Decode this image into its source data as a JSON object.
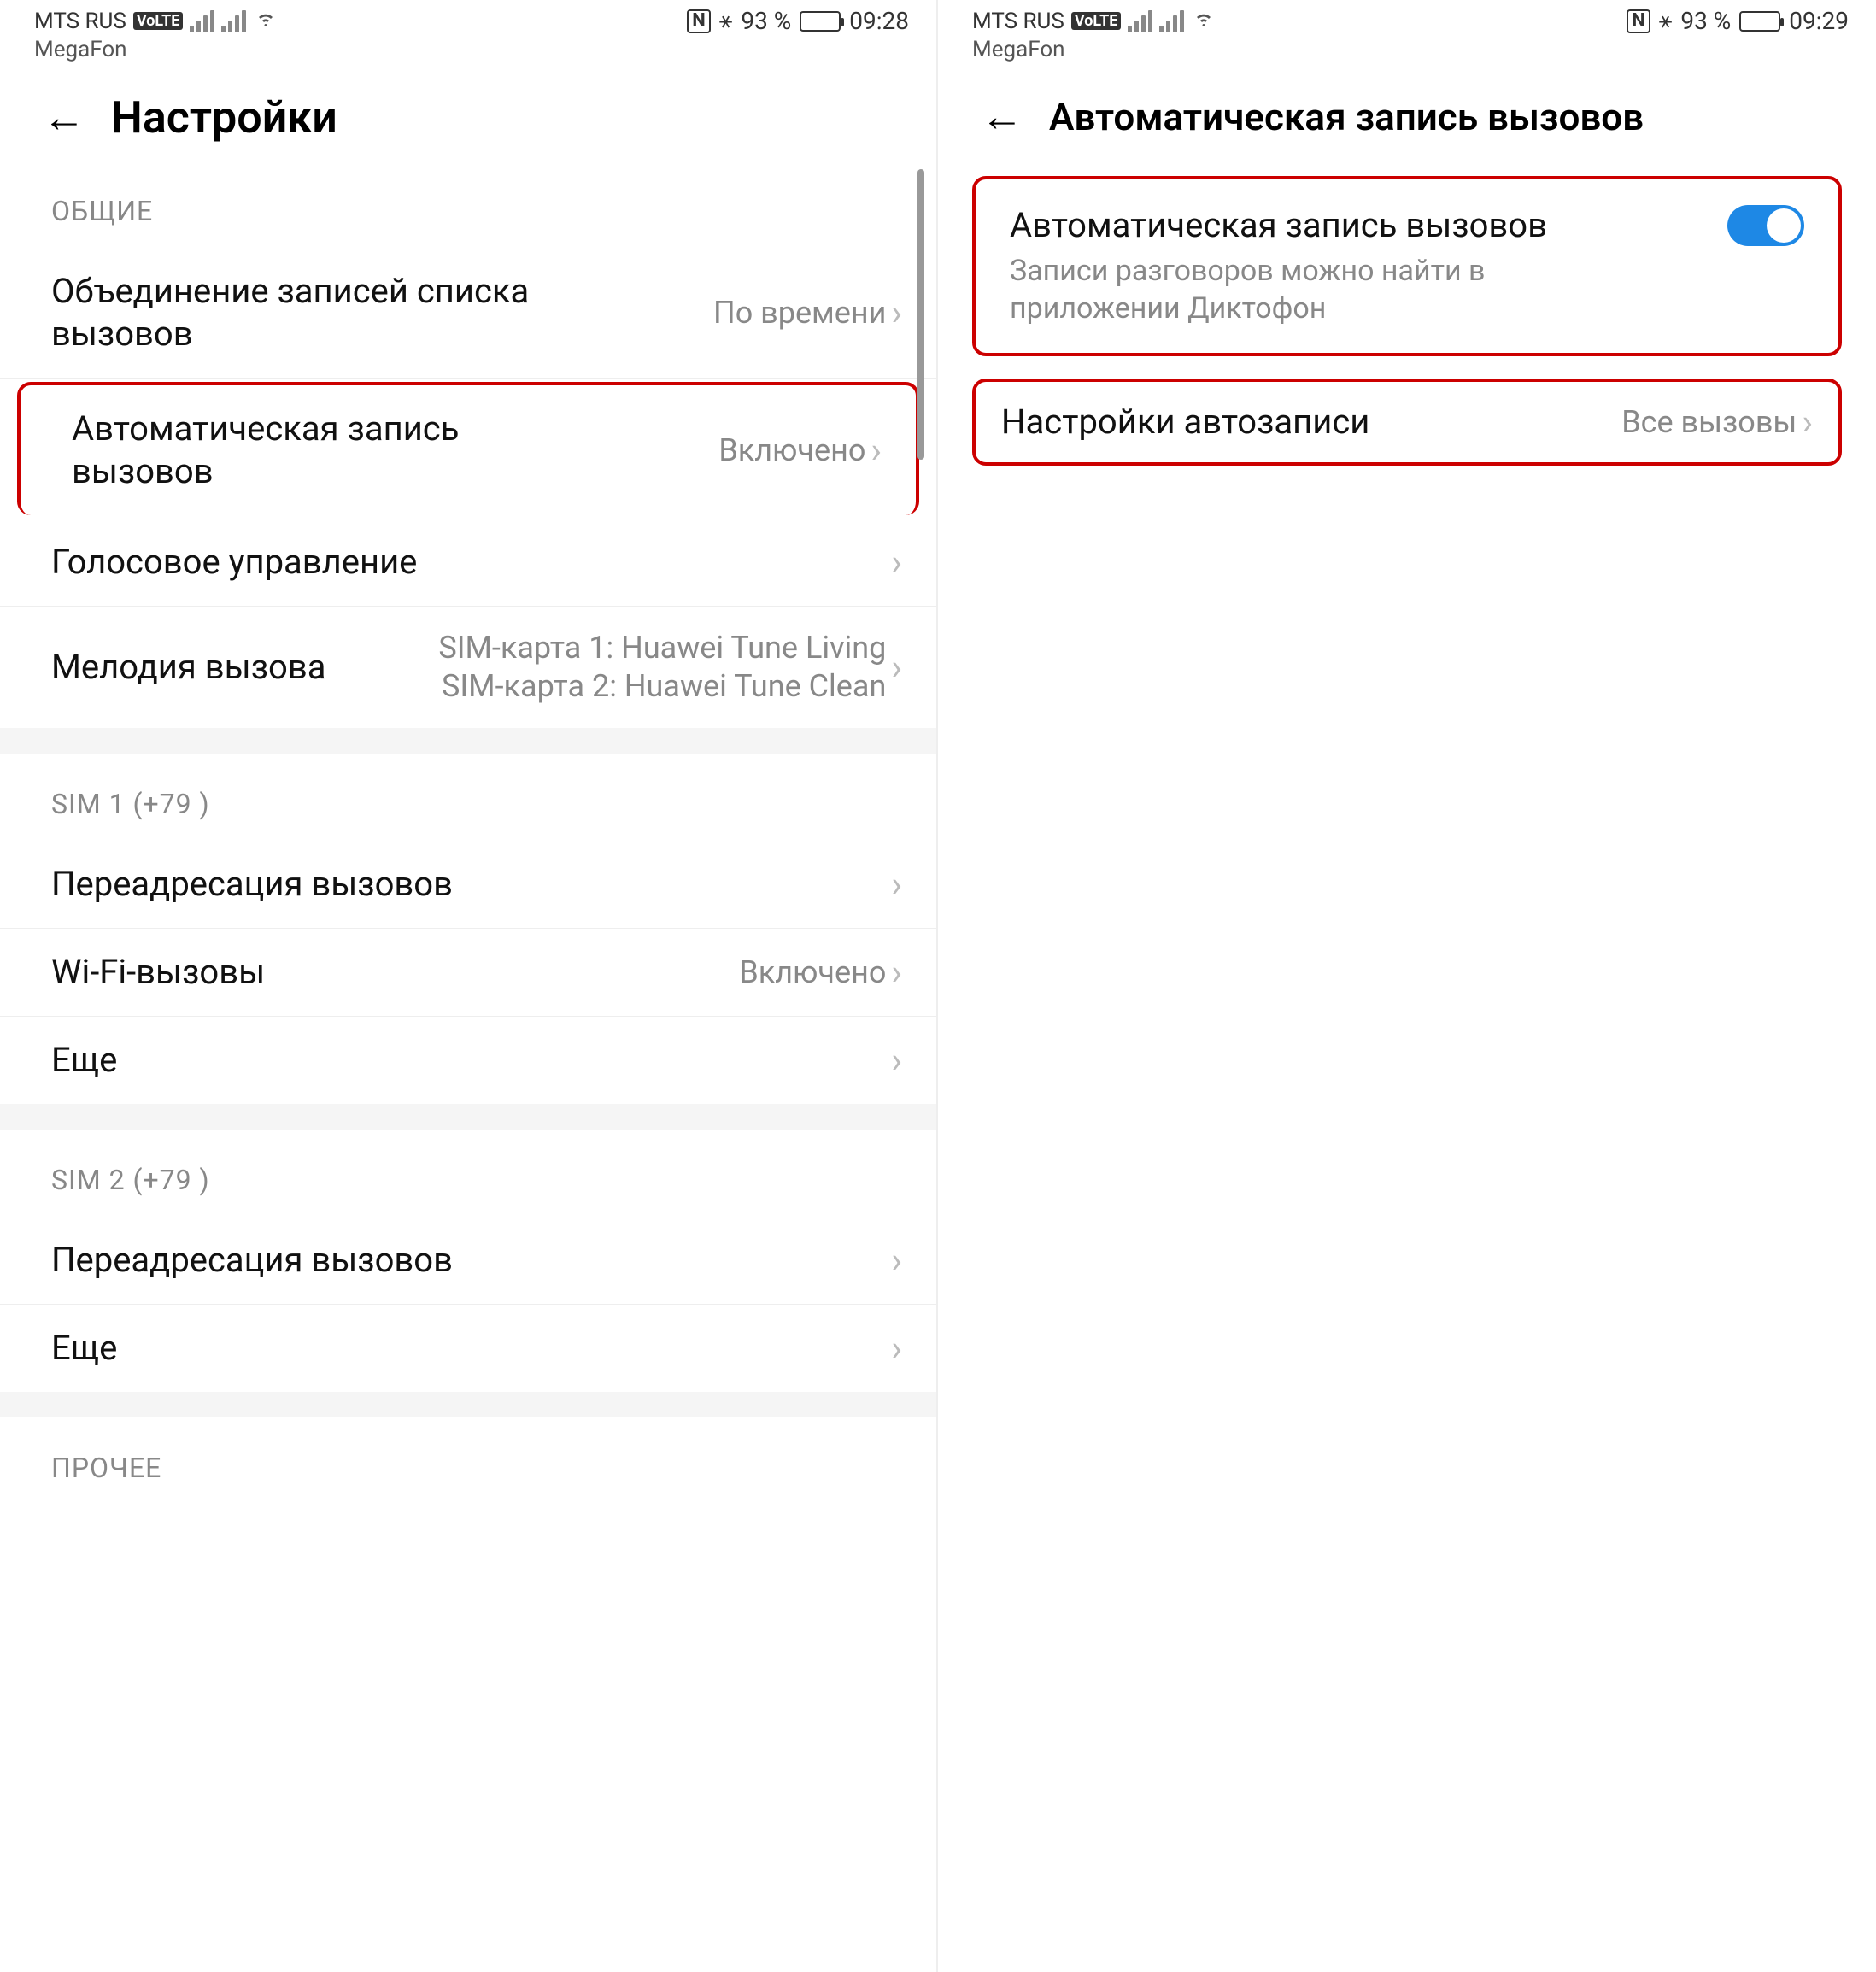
{
  "left": {
    "status": {
      "carrier": "MTS RUS",
      "volte": "VoLTE",
      "carrier_sub": "MegaFon",
      "nfc": "N",
      "bt_battery": "93 %",
      "time": "09:28"
    },
    "title": "Настройки",
    "section_general": "ОБЩИЕ",
    "rows": {
      "merge_calls": {
        "label": "Объединение записей списка вызовов",
        "value": "По времени"
      },
      "auto_record": {
        "label": "Автоматическая запись вызовов",
        "value": "Включено"
      },
      "voice_control": {
        "label": "Голосовое управление"
      },
      "ringtone": {
        "label": "Мелодия вызова",
        "value_line1": "SIM-карта 1: Huawei Tune Living",
        "value_line2": "SIM-карта 2: Huawei Tune Clean"
      }
    },
    "section_sim1": "SIM 1 (+79            )",
    "sim1_rows": {
      "forwarding": {
        "label": "Переадресация вызовов"
      },
      "wifi_calls": {
        "label": "Wi-Fi-вызовы",
        "value": "Включено"
      },
      "more": {
        "label": "Еще"
      }
    },
    "section_sim2": "SIM 2 (+79             )",
    "sim2_rows": {
      "forwarding": {
        "label": "Переадресация вызовов"
      },
      "more": {
        "label": "Еще"
      }
    },
    "section_other": "ПРОЧЕЕ"
  },
  "right": {
    "status": {
      "carrier": "MTS RUS",
      "volte": "VoLTE",
      "carrier_sub": "MegaFon",
      "nfc": "N",
      "bt_battery": "93 %",
      "time": "09:29"
    },
    "title": "Автоматическая запись вызовов",
    "toggle_row": {
      "title": "Автоматическая запись вызовов",
      "subtitle": "Записи разговоров можно найти в приложении Диктофон"
    },
    "settings_row": {
      "label": "Настройки автозаписи",
      "value": "Все вызовы"
    }
  }
}
